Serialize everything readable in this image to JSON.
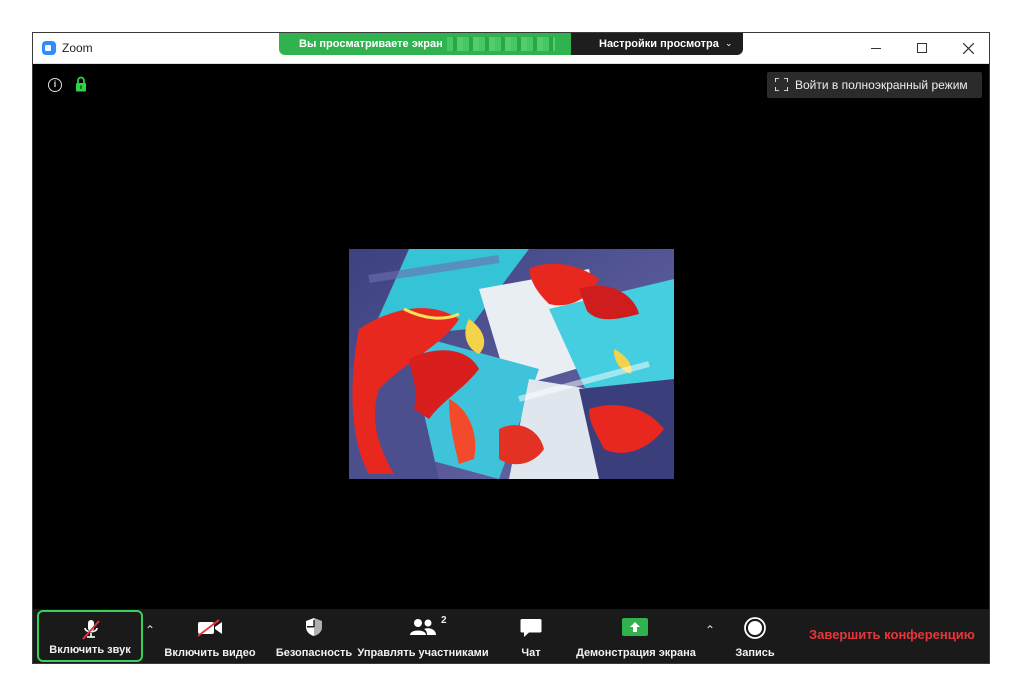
{
  "window": {
    "title": "Zoom"
  },
  "share_banner": {
    "text": "Вы просматриваете экран",
    "view_options": "Настройки просмотра"
  },
  "stage": {
    "fullscreen_label": "Войти в полноэкранный режим"
  },
  "toolbar": {
    "audio_label": "Включить звук",
    "video_label": "Включить видео",
    "security_label": "Безопасность",
    "participants_label": "Управлять участниками",
    "participants_count": "2",
    "chat_label": "Чат",
    "share_label": "Демонстрация экрана",
    "record_label": "Запись",
    "end_label": "Завершить конференцию"
  },
  "colors": {
    "share_green": "#30b34f",
    "end_red": "#e8353c",
    "audio_highlight": "#38d05a",
    "lock_green": "#2fd04a"
  },
  "icons": [
    "zoom-logo-icon",
    "info-icon",
    "lock-icon",
    "fullscreen-icon",
    "mic-muted-icon",
    "video-off-icon",
    "shield-icon",
    "participants-icon",
    "chat-icon",
    "share-screen-icon",
    "record-icon",
    "chevron-up-icon",
    "minimize-icon",
    "maximize-icon",
    "close-icon"
  ]
}
